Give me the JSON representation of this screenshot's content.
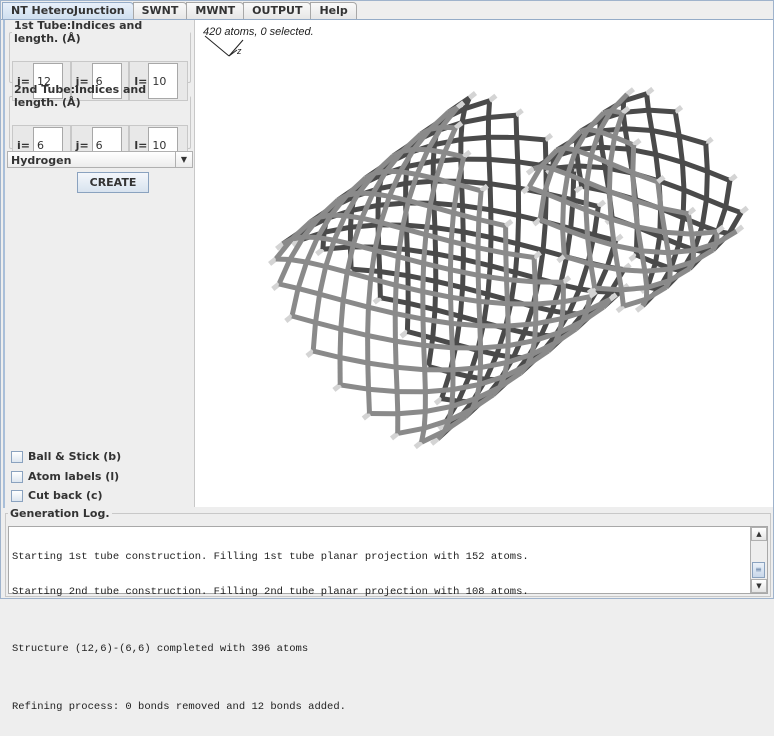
{
  "tabs": [
    {
      "label": "NT HeteroJunction",
      "active": true
    },
    {
      "label": "SWNT",
      "active": false
    },
    {
      "label": "MWNT",
      "active": false
    },
    {
      "label": "OUTPUT",
      "active": false
    },
    {
      "label": "Help",
      "active": false
    }
  ],
  "tube1": {
    "title": "1st Tube:Indices and length. (Å)",
    "i_label": "i=",
    "i_value": "12",
    "j_label": "j=",
    "j_value": "6",
    "l_label": "l=",
    "l_value": "10"
  },
  "tube2": {
    "title": "2nd Tube:Indices and length. (Å)",
    "i_label": "i=",
    "i_value": "6",
    "j_label": "j=",
    "j_value": "6",
    "l_label": "l=",
    "l_value": "10"
  },
  "terminator_select": {
    "value": "Hydrogen"
  },
  "create_label": "CREATE",
  "options": [
    {
      "label": "Ball & Stick (b)",
      "checked": false
    },
    {
      "label": "Atom labels (l)",
      "checked": false
    },
    {
      "label": "Cut back (c)",
      "checked": false
    }
  ],
  "viewer": {
    "status": "420 atoms, 0 selected.",
    "axis_label": "z",
    "bond_colors": {
      "front": "#8a8a8a",
      "back": "#4a4a4a",
      "hydrogen": "#d4d4d4"
    }
  },
  "log": {
    "title": "Generation Log.",
    "lines": [
      "Starting 1st tube construction. Filling 1st tube planar projection with 152 atoms.",
      "Starting 2nd tube construction. Filling 2nd tube planar projection with 108 atoms.",
      "",
      "Structure (12,6)-(6,6) completed with 396 atoms",
      "",
      "Refining process: 0 bonds removed and 12 bonds added."
    ],
    "scroll_position": 0.85
  }
}
